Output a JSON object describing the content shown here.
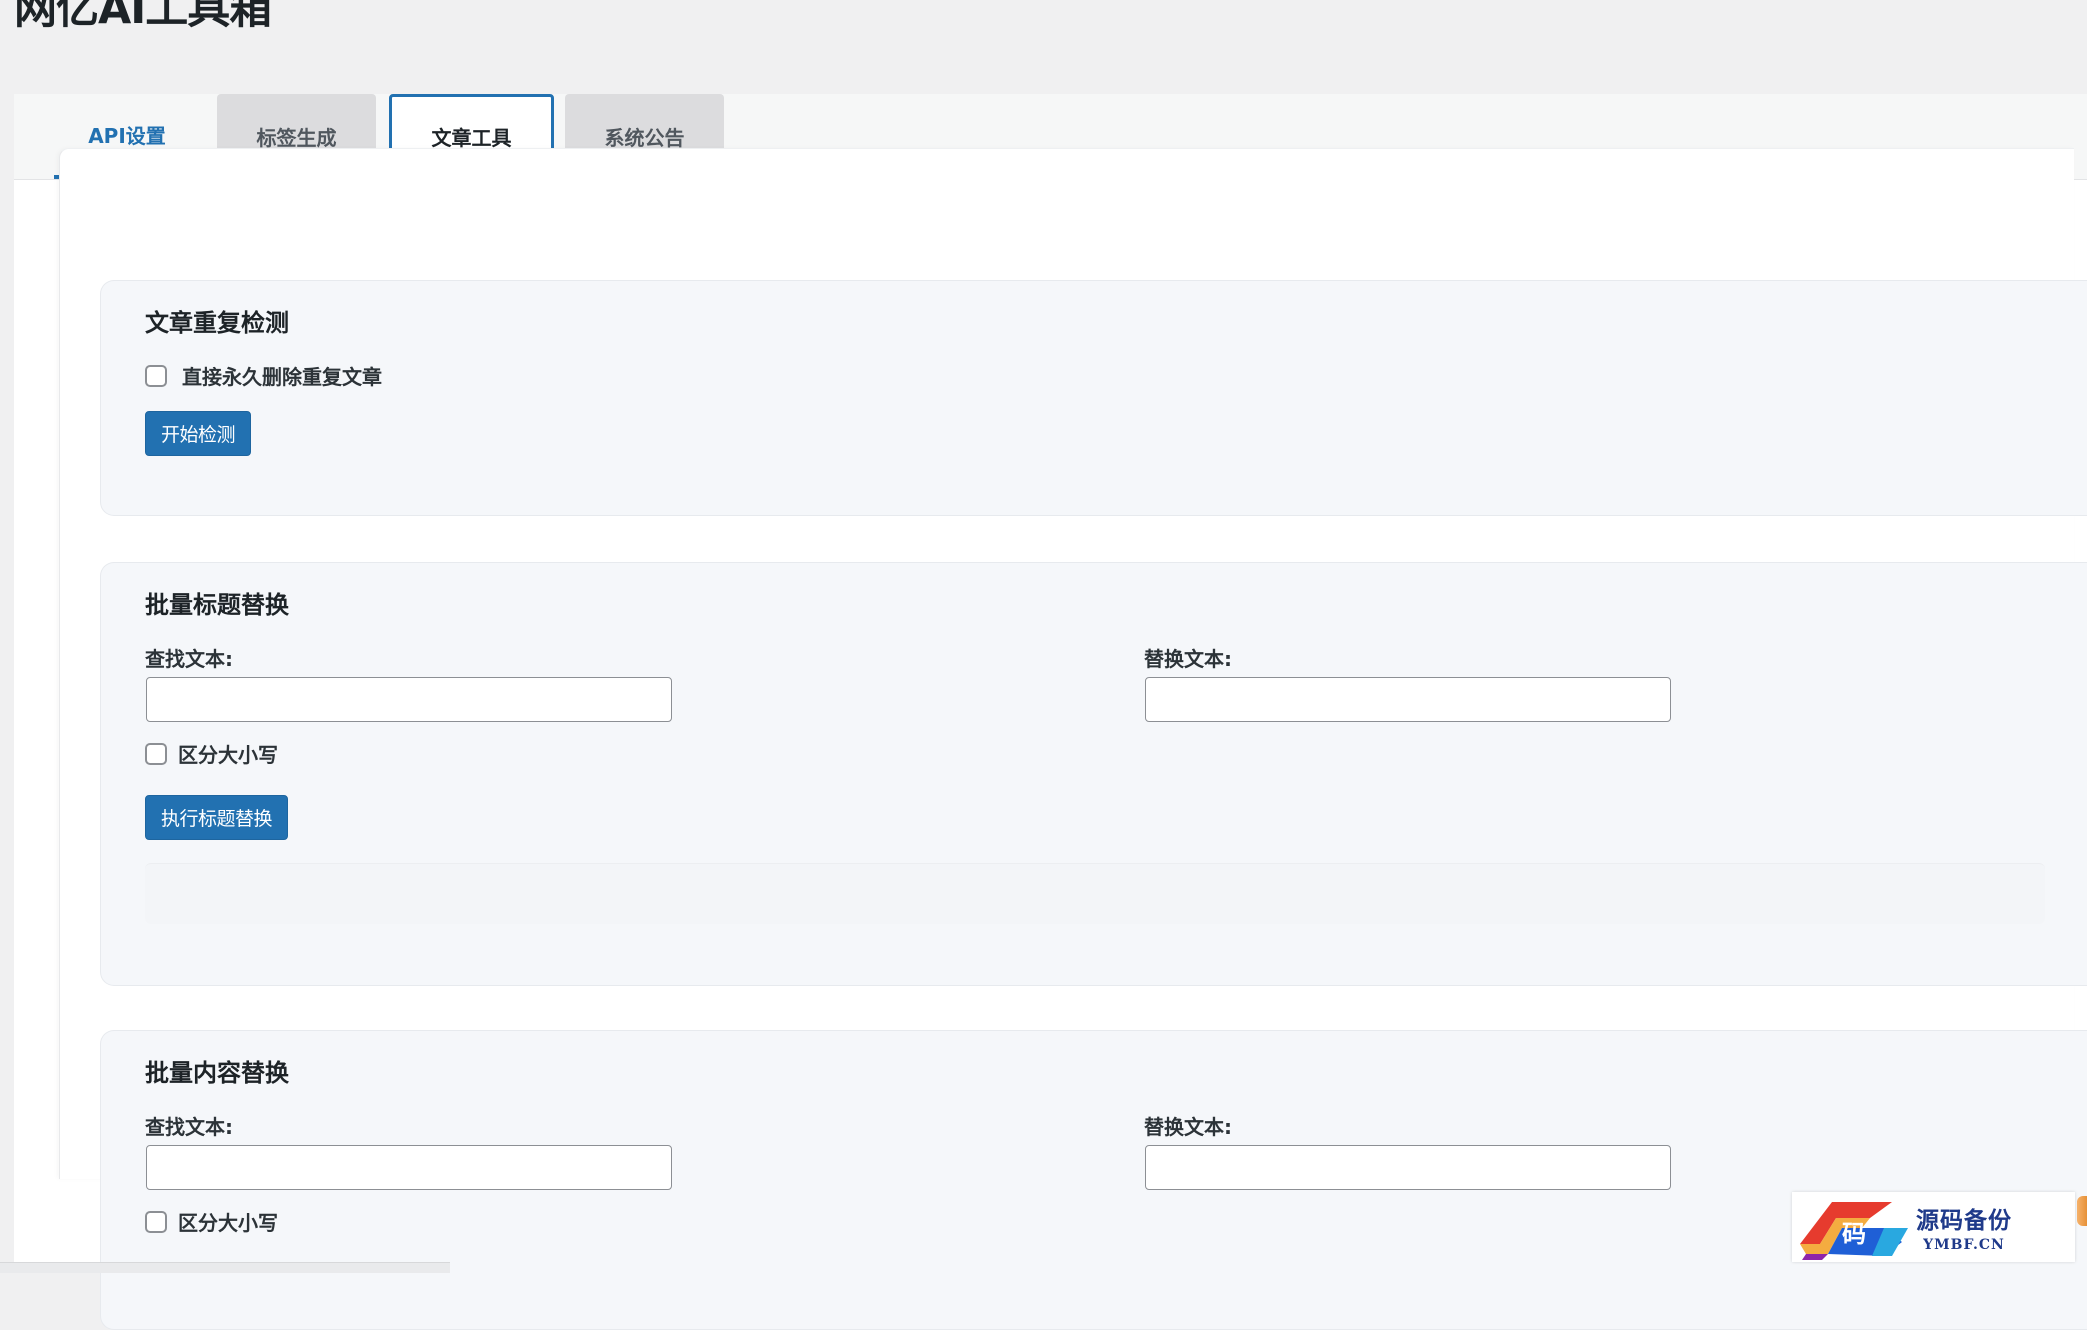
{
  "page": {
    "title": "网亿AI工具箱"
  },
  "tabs": [
    {
      "label": "API设置",
      "state": "hover"
    },
    {
      "label": "标签生成",
      "state": "inactive"
    },
    {
      "label": "文章工具",
      "state": "active"
    },
    {
      "label": "系统公告",
      "state": "inactive"
    }
  ],
  "duplicate_check": {
    "heading": "文章重复检测",
    "checkbox_label": "直接永久删除重复文章",
    "checkbox_checked": false,
    "button_label": "开始检测"
  },
  "title_replace": {
    "heading": "批量标题替换",
    "find_label": "查找文本:",
    "find_value": "",
    "replace_label": "替换文本:",
    "replace_value": "",
    "case_label": "区分大小写",
    "case_checked": false,
    "button_label": "执行标题替换"
  },
  "content_replace": {
    "heading": "批量内容替换",
    "find_label": "查找文本:",
    "find_value": "",
    "replace_label": "替换文本:",
    "replace_value": "",
    "case_label": "区分大小写",
    "case_checked": false
  },
  "watermark": {
    "logo_glyph": "码",
    "cn": "源码备份",
    "en": "YMBF.CN"
  },
  "colors": {
    "accent": "#2271b1",
    "background": "#f0f0f1",
    "card": "#f5f7fa"
  }
}
